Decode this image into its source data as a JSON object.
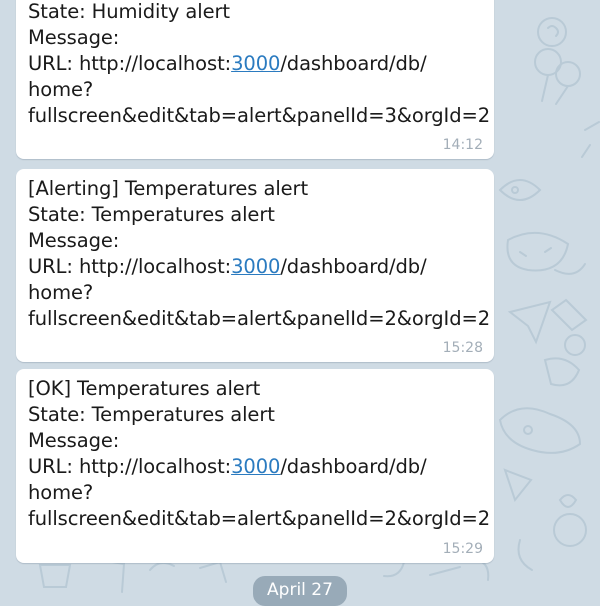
{
  "messages": [
    {
      "line1": "State: Humidity alert",
      "line2": "Message:",
      "url_prefix": "URL: http://localhost:",
      "url_port": "3000",
      "url_suffix": "/dashboard/db/",
      "line4": "home?",
      "line5": "fullscreen&edit&tab=alert&panelId=3&orgId=2",
      "time": "14:12"
    },
    {
      "line0": "[Alerting] Temperatures alert",
      "line1": "State: Temperatures alert",
      "line2": "Message:",
      "url_prefix": "URL: http://localhost:",
      "url_port": "3000",
      "url_suffix": "/dashboard/db/",
      "line4": "home?",
      "line5": "fullscreen&edit&tab=alert&panelId=2&orgId=2",
      "time": "15:28"
    },
    {
      "line0": "[OK] Temperatures alert",
      "line1": "State: Temperatures alert",
      "line2": "Message:",
      "url_prefix": "URL: http://localhost:",
      "url_port": "3000",
      "url_suffix": "/dashboard/db/",
      "line4": "home?",
      "line5": "fullscreen&edit&tab=alert&panelId=2&orgId=2",
      "time": "15:29"
    }
  ],
  "date_separator": "April 27",
  "colors": {
    "background": "#cfdbe4",
    "bubble": "#ffffff",
    "link": "#2b7bc0",
    "timestamp": "#a3aeb8",
    "date_pill": "#98aab8"
  }
}
